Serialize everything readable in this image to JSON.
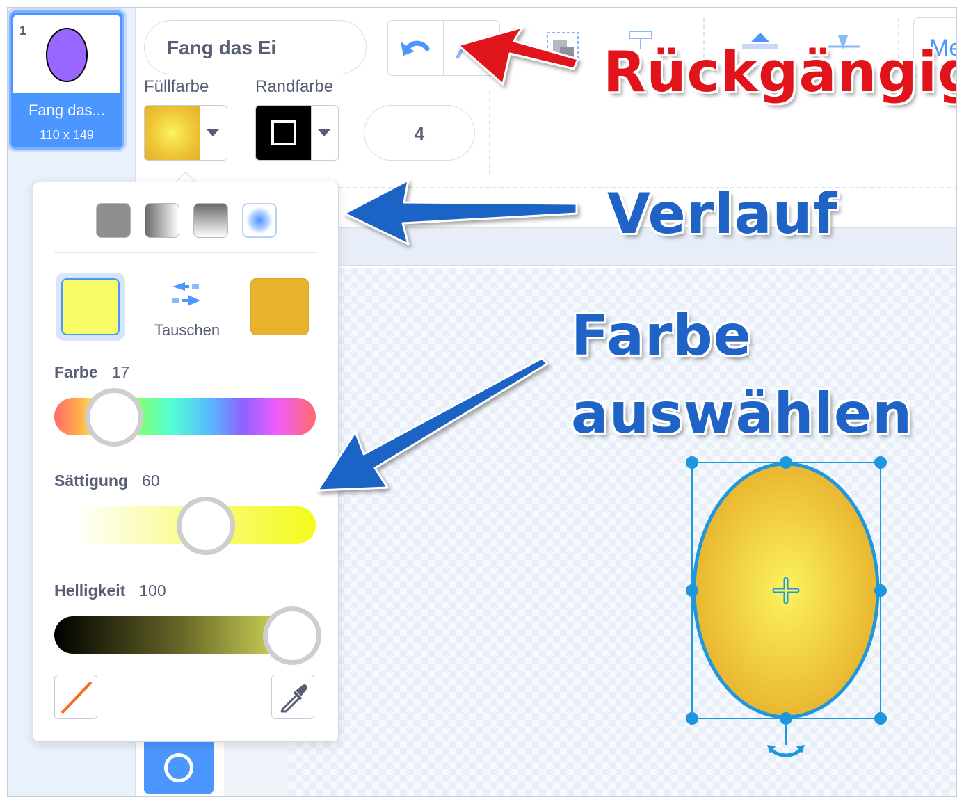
{
  "costume": {
    "number": "1",
    "name": "Fang das...",
    "size": "110 x 149"
  },
  "toolbar": {
    "costume_name": "Fang das Ei",
    "fill_label": "Füllfarbe",
    "outline_label": "Randfarbe",
    "outline_width": "4",
    "more_label": "Me"
  },
  "color_popover": {
    "swap_label": "Tauschen",
    "primary_color": "#f8fc66",
    "secondary_color": "#e7b22e",
    "hue": {
      "label": "Farbe",
      "value": "17"
    },
    "saturation": {
      "label": "Sättigung",
      "value": "60"
    },
    "brightness": {
      "label": "Helligkeit",
      "value": "100"
    },
    "gradient_modes": [
      "solid",
      "horizontal",
      "vertical",
      "radial"
    ],
    "selected_gradient": "radial"
  },
  "annotations": {
    "undo": "Rückgängig",
    "gradient": "Verlauf",
    "pick_color_line1": "Farbe",
    "pick_color_line2": "auswählen"
  },
  "colors": {
    "accent_blue": "#4c97ff",
    "annotation_red": "#e1141b",
    "annotation_blue": "#1f63c6",
    "egg_fill_light": "#fbf35e",
    "egg_fill_dark": "#e8b02c",
    "costume_thumb_fill": "#9966ff"
  }
}
